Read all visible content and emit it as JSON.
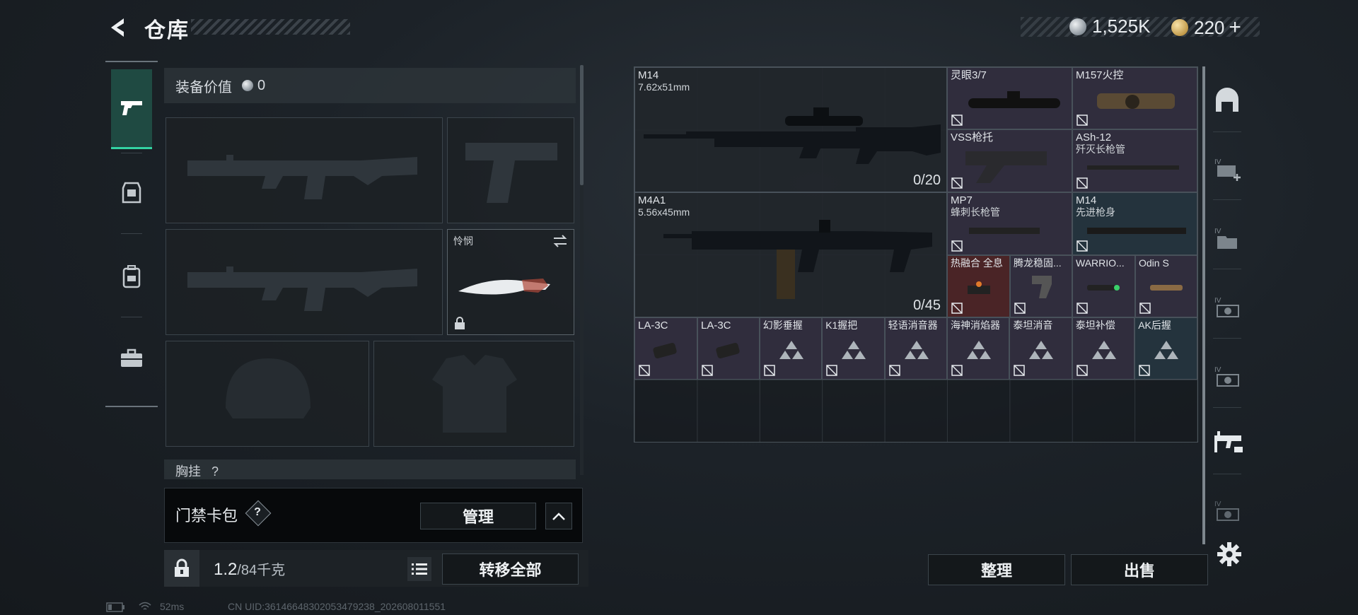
{
  "header": {
    "title": "仓库"
  },
  "currency": {
    "silver": "1,525K",
    "gold": "220"
  },
  "equipment": {
    "value_label": "装备价值",
    "value": "0",
    "melee_name": "怜悯",
    "chest_label": "胸挂",
    "chest_count": "?"
  },
  "keycard": {
    "label": "门禁卡包",
    "help": "?",
    "manage": "管理"
  },
  "capacity": {
    "current": "1.2",
    "max": "/84千克",
    "transfer": "转移全部"
  },
  "inventory": {
    "items": [
      {
        "name": "M14",
        "sub": "7.62x51mm",
        "ammo": "0/20"
      },
      {
        "name": "M4A1",
        "sub": "5.56x45mm",
        "ammo": "0/45"
      },
      {
        "name": "灵眼3/7"
      },
      {
        "name": "M157火控"
      },
      {
        "name": "VSS枪托"
      },
      {
        "name": "ASh-12",
        "sub": "歼灭长枪管"
      },
      {
        "name": "MP7",
        "sub": "蜂刺长枪管"
      },
      {
        "name": "M14",
        "sub": "先进枪身"
      },
      {
        "name": "热融合 全息"
      },
      {
        "name": "腾龙稳固..."
      },
      {
        "name": "WARRIO..."
      },
      {
        "name": "Odin S"
      },
      {
        "name": "LA-3C"
      },
      {
        "name": "LA-3C"
      },
      {
        "name": "幻影垂握"
      },
      {
        "name": "K1握把"
      },
      {
        "name": "轻语消音器"
      },
      {
        "name": "海神消焰器"
      },
      {
        "name": "泰坦消音"
      },
      {
        "name": "泰坦补偿"
      },
      {
        "name": "AK后握"
      }
    ]
  },
  "actions": {
    "sort": "整理",
    "sell": "出售"
  },
  "status": {
    "ping": "52ms",
    "uid": "CN UID:3614664830205347923​8_202608011551"
  },
  "colors": {
    "accent": "#33d3a3",
    "purple_rarity": "#302d3d",
    "blue_rarity": "#24333d",
    "red_rarity": "#4a2426"
  },
  "icons": [
    "back-arrow-icon",
    "pistol-icon",
    "armor-icon",
    "backpack-icon",
    "briefcase-icon",
    "lock-icon",
    "list-icon",
    "gear-icon",
    "swap-icon",
    "no-insurance-icon",
    "chevron-up-icon"
  ]
}
